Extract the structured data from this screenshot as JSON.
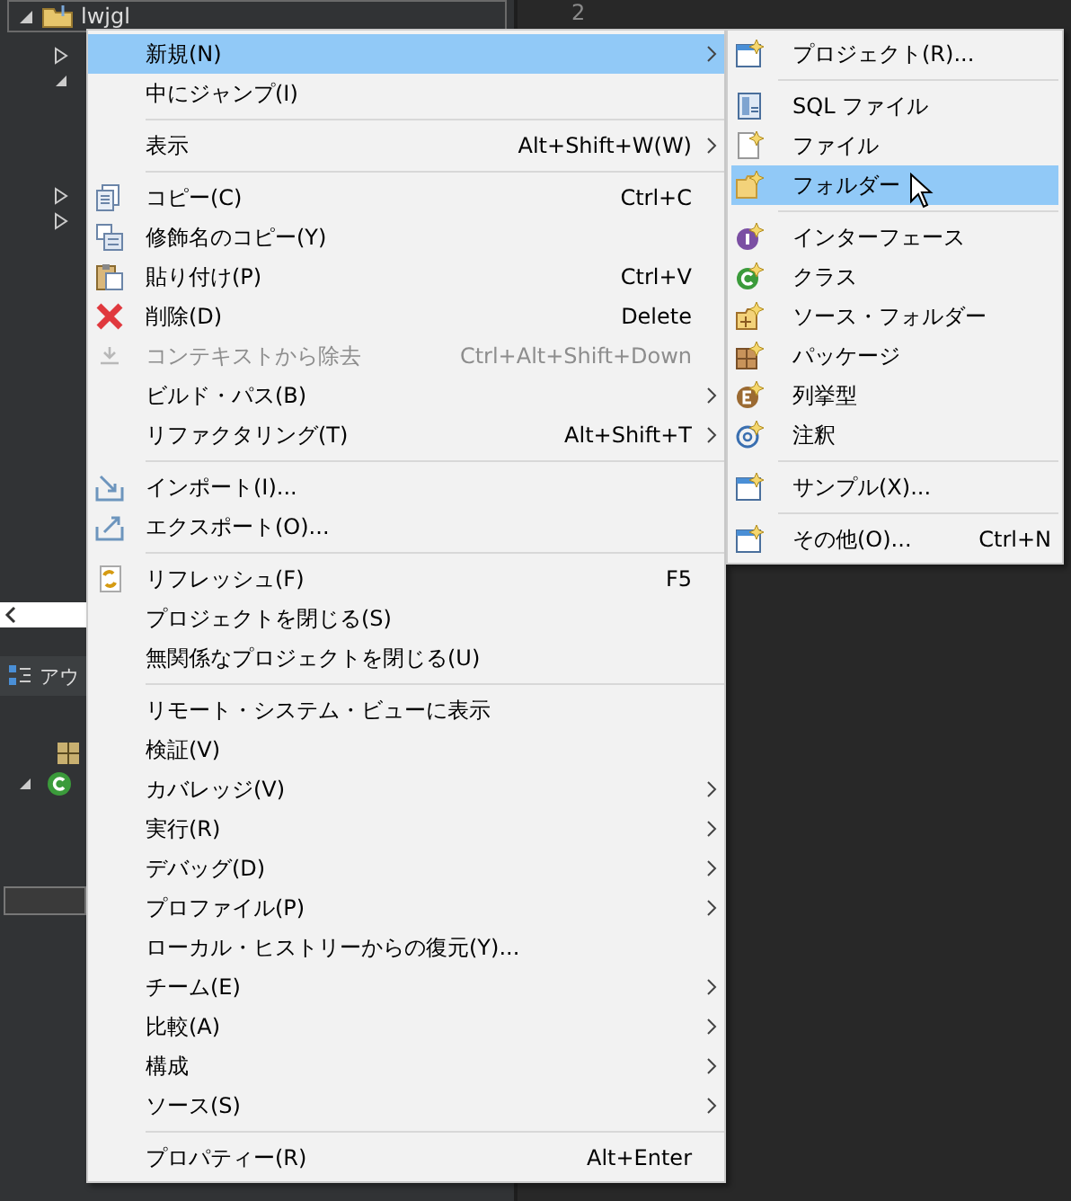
{
  "explorer": {
    "project": {
      "label": "lwjgl",
      "expanded": true
    }
  },
  "editor": {
    "line_number": "2"
  },
  "outline": {
    "title": "アウ"
  },
  "context_menu": {
    "items": [
      {
        "kind": "item",
        "label": "新規(N)",
        "submenu": true,
        "selected": true
      },
      {
        "kind": "item",
        "label": "中にジャンプ(I)",
        "submenu": false,
        "selected": false
      },
      {
        "kind": "separator"
      },
      {
        "kind": "item",
        "label": "表示",
        "shortcut": "Alt+Shift+W(W)",
        "submenu": true,
        "selected": false
      },
      {
        "kind": "separator"
      },
      {
        "kind": "copy",
        "label": "コピー(C)",
        "shortcut": "Ctrl+C",
        "submenu": false,
        "selected": false
      },
      {
        "kind": "copy-qualified",
        "label": "修飾名のコピー(Y)",
        "submenu": false,
        "selected": false
      },
      {
        "kind": "paste",
        "label": "貼り付け(P)",
        "shortcut": "Ctrl+V",
        "submenu": false,
        "selected": false
      },
      {
        "kind": "delete",
        "label": "削除(D)",
        "shortcut": "Delete",
        "submenu": false,
        "selected": false
      },
      {
        "kind": "remove",
        "label": "コンテキストから除去",
        "shortcut": "Ctrl+Alt+Shift+Down",
        "submenu": false,
        "selected": false,
        "disabled": true
      },
      {
        "kind": "item",
        "label": "ビルド・パス(B)",
        "submenu": true,
        "selected": false
      },
      {
        "kind": "item",
        "label": "リファクタリング(T)",
        "shortcut": "Alt+Shift+T",
        "submenu": true,
        "selected": false
      },
      {
        "kind": "separator"
      },
      {
        "kind": "import",
        "label": "インポート(I)...",
        "submenu": false,
        "selected": false
      },
      {
        "kind": "export",
        "label": "エクスポート(O)...",
        "submenu": false,
        "selected": false
      },
      {
        "kind": "separator"
      },
      {
        "kind": "refresh",
        "label": "リフレッシュ(F)",
        "shortcut": "F5",
        "submenu": false,
        "selected": false
      },
      {
        "kind": "item",
        "label": "プロジェクトを閉じる(S)",
        "submenu": false,
        "selected": false
      },
      {
        "kind": "item",
        "label": "無関係なプロジェクトを閉じる(U)",
        "submenu": false,
        "selected": false
      },
      {
        "kind": "separator"
      },
      {
        "kind": "item",
        "label": "リモート・システム・ビューに表示",
        "submenu": false,
        "selected": false
      },
      {
        "kind": "item",
        "label": "検証(V)",
        "submenu": false,
        "selected": false
      },
      {
        "kind": "item",
        "label": "カバレッジ(V)",
        "submenu": true,
        "selected": false
      },
      {
        "kind": "item",
        "label": "実行(R)",
        "submenu": true,
        "selected": false
      },
      {
        "kind": "item",
        "label": "デバッグ(D)",
        "submenu": true,
        "selected": false
      },
      {
        "kind": "item",
        "label": "プロファイル(P)",
        "submenu": true,
        "selected": false
      },
      {
        "kind": "item",
        "label": "ローカル・ヒストリーからの復元(Y)...",
        "submenu": false,
        "selected": false
      },
      {
        "kind": "item",
        "label": "チーム(E)",
        "submenu": true,
        "selected": false
      },
      {
        "kind": "item",
        "label": "比較(A)",
        "submenu": true,
        "selected": false
      },
      {
        "kind": "item",
        "label": "構成",
        "submenu": true,
        "selected": false
      },
      {
        "kind": "item",
        "label": "ソース(S)",
        "submenu": true,
        "selected": false
      },
      {
        "kind": "separator"
      },
      {
        "kind": "item",
        "label": "プロパティー(R)",
        "shortcut": "Alt+Enter",
        "submenu": false,
        "selected": false
      }
    ]
  },
  "new_submenu": {
    "items": [
      {
        "kind": "new-window",
        "label": "プロジェクト(R)...",
        "selected": false
      },
      {
        "kind": "separator"
      },
      {
        "kind": "sql-file",
        "label": "SQL ファイル",
        "selected": false
      },
      {
        "kind": "new-file",
        "label": "ファイル",
        "selected": false
      },
      {
        "kind": "new-folder",
        "label": "フォルダー",
        "selected": true
      },
      {
        "kind": "separator"
      },
      {
        "kind": "interface",
        "label": "インターフェース",
        "selected": false
      },
      {
        "kind": "class",
        "label": "クラス",
        "selected": false
      },
      {
        "kind": "source-folder",
        "label": "ソース・フォルダー",
        "selected": false
      },
      {
        "kind": "package",
        "label": "パッケージ",
        "selected": false
      },
      {
        "kind": "enum",
        "label": "列挙型",
        "selected": false
      },
      {
        "kind": "annotation",
        "label": "注釈",
        "selected": false
      },
      {
        "kind": "separator"
      },
      {
        "kind": "new-window",
        "label": "サンプル(X)...",
        "selected": false
      },
      {
        "kind": "separator"
      },
      {
        "kind": "new-window",
        "label": "その他(O)...",
        "shortcut": "Ctrl+N",
        "selected": false
      }
    ]
  }
}
